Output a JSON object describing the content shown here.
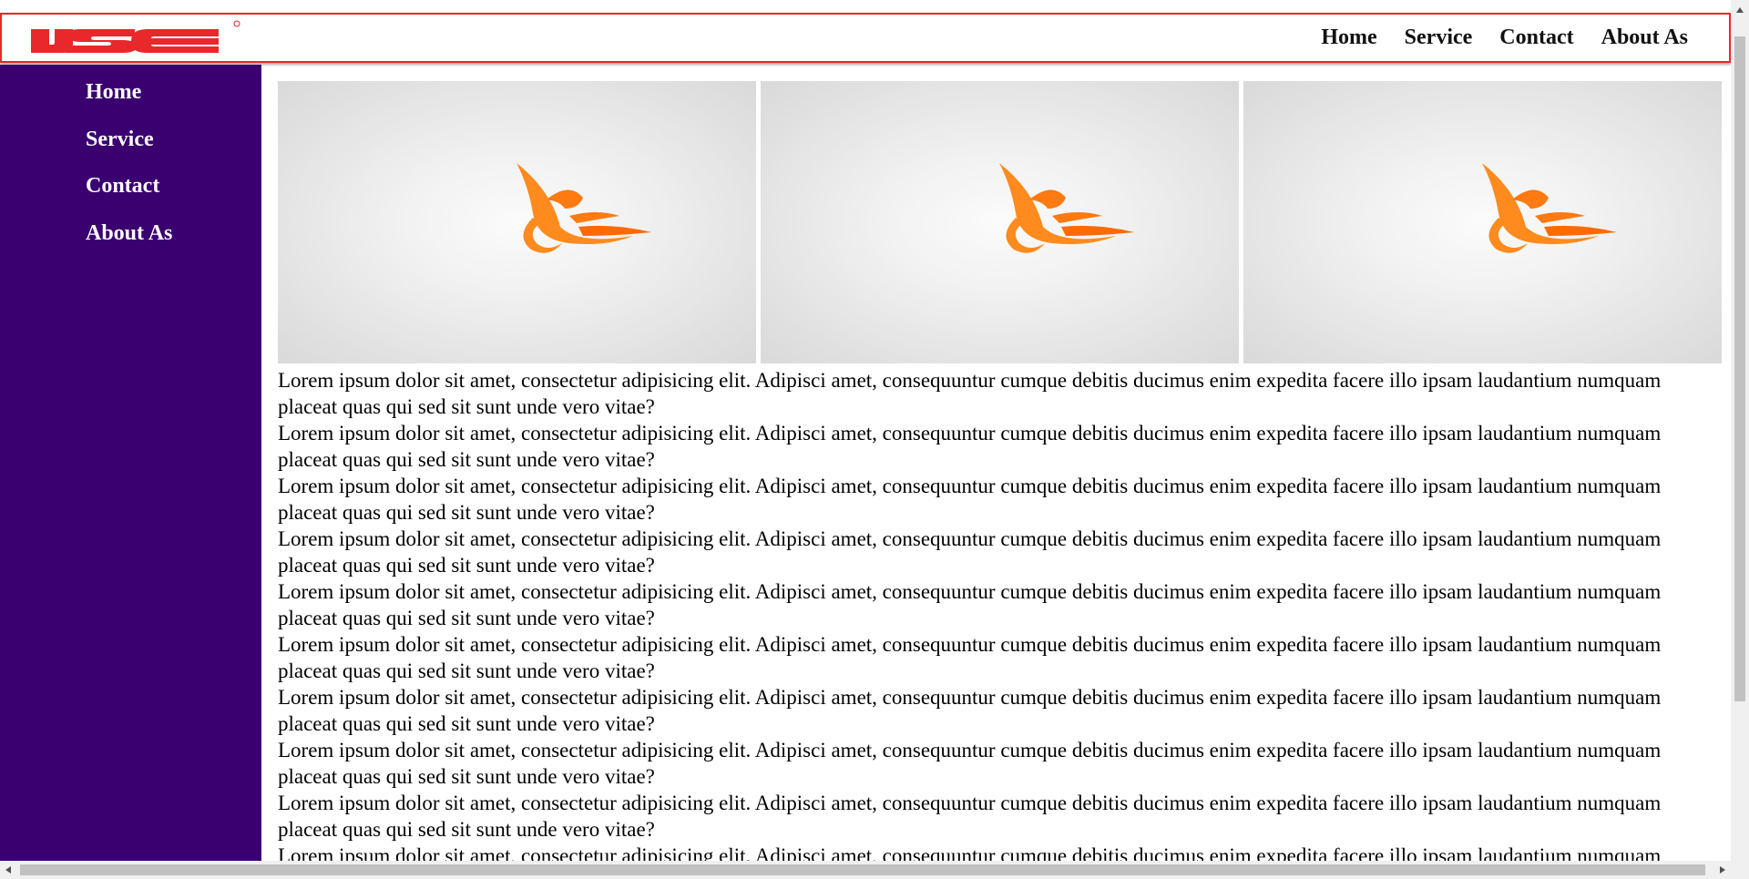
{
  "brand": {
    "logo_text": "IJSE",
    "accent_color": "#e8282b",
    "logo_color": "#e8282b"
  },
  "top_nav": [
    {
      "label": "Home"
    },
    {
      "label": "Service"
    },
    {
      "label": "Contact"
    },
    {
      "label": "About As"
    }
  ],
  "sidebar": {
    "background": "#3a0070",
    "items": [
      {
        "label": "Home"
      },
      {
        "label": "Service"
      },
      {
        "label": "Contact"
      },
      {
        "label": "About As"
      }
    ]
  },
  "gallery": [
    {
      "icon": "orange-bird-logo"
    },
    {
      "icon": "orange-bird-logo"
    },
    {
      "icon": "orange-bird-logo"
    }
  ],
  "content": {
    "paragraphs": [
      "Lorem ipsum dolor sit amet, consectetur adipisicing elit. Adipisci amet, consequuntur cumque debitis ducimus enim expedita facere illo ipsam laudantium numquam placeat quas qui sed sit sunt unde vero vitae?",
      "Lorem ipsum dolor sit amet, consectetur adipisicing elit. Adipisci amet, consequuntur cumque debitis ducimus enim expedita facere illo ipsam laudantium numquam placeat quas qui sed sit sunt unde vero vitae?",
      "Lorem ipsum dolor sit amet, consectetur adipisicing elit. Adipisci amet, consequuntur cumque debitis ducimus enim expedita facere illo ipsam laudantium numquam placeat quas qui sed sit sunt unde vero vitae?",
      "Lorem ipsum dolor sit amet, consectetur adipisicing elit. Adipisci amet, consequuntur cumque debitis ducimus enim expedita facere illo ipsam laudantium numquam placeat quas qui sed sit sunt unde vero vitae?",
      "Lorem ipsum dolor sit amet, consectetur adipisicing elit. Adipisci amet, consequuntur cumque debitis ducimus enim expedita facere illo ipsam laudantium numquam placeat quas qui sed sit sunt unde vero vitae?",
      "Lorem ipsum dolor sit amet, consectetur adipisicing elit. Adipisci amet, consequuntur cumque debitis ducimus enim expedita facere illo ipsam laudantium numquam placeat quas qui sed sit sunt unde vero vitae?",
      "Lorem ipsum dolor sit amet, consectetur adipisicing elit. Adipisci amet, consequuntur cumque debitis ducimus enim expedita facere illo ipsam laudantium numquam placeat quas qui sed sit sunt unde vero vitae?",
      "Lorem ipsum dolor sit amet, consectetur adipisicing elit. Adipisci amet, consequuntur cumque debitis ducimus enim expedita facere illo ipsam laudantium numquam placeat quas qui sed sit sunt unde vero vitae?",
      "Lorem ipsum dolor sit amet, consectetur adipisicing elit. Adipisci amet, consequuntur cumque debitis ducimus enim expedita facere illo ipsam laudantium numquam placeat quas qui sed sit sunt unde vero vitae?",
      "Lorem ipsum dolor sit amet, consectetur adipisicing elit. Adipisci amet, consequuntur cumque debitis ducimus enim expedita facere illo ipsam laudantium numquam placeat quas qui sed sit sunt unde vero vitae?"
    ]
  }
}
